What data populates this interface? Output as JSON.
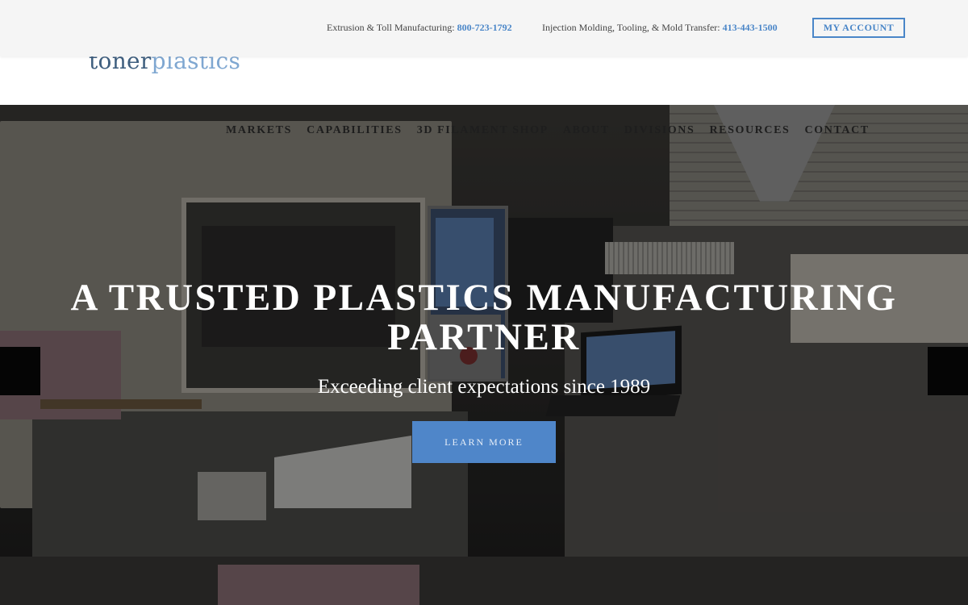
{
  "topbar": {
    "extrusion_label": "Extrusion & Toll Manufacturing: ",
    "extrusion_phone": "800-723-1792",
    "molding_label": "Injection Molding, Tooling, & Mold Transfer: ",
    "molding_phone": "413-443-1500",
    "account_button": "MY ACCOUNT"
  },
  "logo": {
    "part1": "toner",
    "part2": "plastics"
  },
  "nav": {
    "items": [
      "MARKETS",
      "CAPABILITIES",
      "3D FILAMENT SHOP",
      "ABOUT",
      "DIVISIONS",
      "RESOURCES",
      "CONTACT"
    ]
  },
  "hero": {
    "title": "A TRUSTED PLASTICS MANUFACTURING PARTNER",
    "subtitle": "Exceeding client expectations since 1989",
    "button": "LEARN MORE"
  },
  "colors": {
    "accent": "#4a86c8",
    "button": "#4f86c9",
    "logo_dark": "#3f5f7f",
    "logo_light": "#7fa7d1"
  }
}
